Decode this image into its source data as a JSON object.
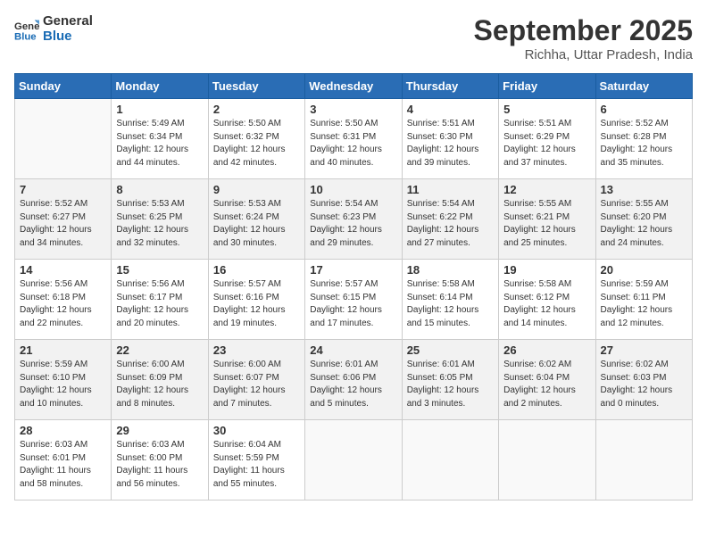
{
  "header": {
    "logo_line1": "General",
    "logo_line2": "Blue",
    "month": "September 2025",
    "location": "Richha, Uttar Pradesh, India"
  },
  "weekdays": [
    "Sunday",
    "Monday",
    "Tuesday",
    "Wednesday",
    "Thursday",
    "Friday",
    "Saturday"
  ],
  "weeks": [
    [
      {
        "day": "",
        "sunrise": "",
        "sunset": "",
        "daylight": ""
      },
      {
        "day": "1",
        "sunrise": "Sunrise: 5:49 AM",
        "sunset": "Sunset: 6:34 PM",
        "daylight": "Daylight: 12 hours and 44 minutes."
      },
      {
        "day": "2",
        "sunrise": "Sunrise: 5:50 AM",
        "sunset": "Sunset: 6:32 PM",
        "daylight": "Daylight: 12 hours and 42 minutes."
      },
      {
        "day": "3",
        "sunrise": "Sunrise: 5:50 AM",
        "sunset": "Sunset: 6:31 PM",
        "daylight": "Daylight: 12 hours and 40 minutes."
      },
      {
        "day": "4",
        "sunrise": "Sunrise: 5:51 AM",
        "sunset": "Sunset: 6:30 PM",
        "daylight": "Daylight: 12 hours and 39 minutes."
      },
      {
        "day": "5",
        "sunrise": "Sunrise: 5:51 AM",
        "sunset": "Sunset: 6:29 PM",
        "daylight": "Daylight: 12 hours and 37 minutes."
      },
      {
        "day": "6",
        "sunrise": "Sunrise: 5:52 AM",
        "sunset": "Sunset: 6:28 PM",
        "daylight": "Daylight: 12 hours and 35 minutes."
      }
    ],
    [
      {
        "day": "7",
        "sunrise": "Sunrise: 5:52 AM",
        "sunset": "Sunset: 6:27 PM",
        "daylight": "Daylight: 12 hours and 34 minutes."
      },
      {
        "day": "8",
        "sunrise": "Sunrise: 5:53 AM",
        "sunset": "Sunset: 6:25 PM",
        "daylight": "Daylight: 12 hours and 32 minutes."
      },
      {
        "day": "9",
        "sunrise": "Sunrise: 5:53 AM",
        "sunset": "Sunset: 6:24 PM",
        "daylight": "Daylight: 12 hours and 30 minutes."
      },
      {
        "day": "10",
        "sunrise": "Sunrise: 5:54 AM",
        "sunset": "Sunset: 6:23 PM",
        "daylight": "Daylight: 12 hours and 29 minutes."
      },
      {
        "day": "11",
        "sunrise": "Sunrise: 5:54 AM",
        "sunset": "Sunset: 6:22 PM",
        "daylight": "Daylight: 12 hours and 27 minutes."
      },
      {
        "day": "12",
        "sunrise": "Sunrise: 5:55 AM",
        "sunset": "Sunset: 6:21 PM",
        "daylight": "Daylight: 12 hours and 25 minutes."
      },
      {
        "day": "13",
        "sunrise": "Sunrise: 5:55 AM",
        "sunset": "Sunset: 6:20 PM",
        "daylight": "Daylight: 12 hours and 24 minutes."
      }
    ],
    [
      {
        "day": "14",
        "sunrise": "Sunrise: 5:56 AM",
        "sunset": "Sunset: 6:18 PM",
        "daylight": "Daylight: 12 hours and 22 minutes."
      },
      {
        "day": "15",
        "sunrise": "Sunrise: 5:56 AM",
        "sunset": "Sunset: 6:17 PM",
        "daylight": "Daylight: 12 hours and 20 minutes."
      },
      {
        "day": "16",
        "sunrise": "Sunrise: 5:57 AM",
        "sunset": "Sunset: 6:16 PM",
        "daylight": "Daylight: 12 hours and 19 minutes."
      },
      {
        "day": "17",
        "sunrise": "Sunrise: 5:57 AM",
        "sunset": "Sunset: 6:15 PM",
        "daylight": "Daylight: 12 hours and 17 minutes."
      },
      {
        "day": "18",
        "sunrise": "Sunrise: 5:58 AM",
        "sunset": "Sunset: 6:14 PM",
        "daylight": "Daylight: 12 hours and 15 minutes."
      },
      {
        "day": "19",
        "sunrise": "Sunrise: 5:58 AM",
        "sunset": "Sunset: 6:12 PM",
        "daylight": "Daylight: 12 hours and 14 minutes."
      },
      {
        "day": "20",
        "sunrise": "Sunrise: 5:59 AM",
        "sunset": "Sunset: 6:11 PM",
        "daylight": "Daylight: 12 hours and 12 minutes."
      }
    ],
    [
      {
        "day": "21",
        "sunrise": "Sunrise: 5:59 AM",
        "sunset": "Sunset: 6:10 PM",
        "daylight": "Daylight: 12 hours and 10 minutes."
      },
      {
        "day": "22",
        "sunrise": "Sunrise: 6:00 AM",
        "sunset": "Sunset: 6:09 PM",
        "daylight": "Daylight: 12 hours and 8 minutes."
      },
      {
        "day": "23",
        "sunrise": "Sunrise: 6:00 AM",
        "sunset": "Sunset: 6:07 PM",
        "daylight": "Daylight: 12 hours and 7 minutes."
      },
      {
        "day": "24",
        "sunrise": "Sunrise: 6:01 AM",
        "sunset": "Sunset: 6:06 PM",
        "daylight": "Daylight: 12 hours and 5 minutes."
      },
      {
        "day": "25",
        "sunrise": "Sunrise: 6:01 AM",
        "sunset": "Sunset: 6:05 PM",
        "daylight": "Daylight: 12 hours and 3 minutes."
      },
      {
        "day": "26",
        "sunrise": "Sunrise: 6:02 AM",
        "sunset": "Sunset: 6:04 PM",
        "daylight": "Daylight: 12 hours and 2 minutes."
      },
      {
        "day": "27",
        "sunrise": "Sunrise: 6:02 AM",
        "sunset": "Sunset: 6:03 PM",
        "daylight": "Daylight: 12 hours and 0 minutes."
      }
    ],
    [
      {
        "day": "28",
        "sunrise": "Sunrise: 6:03 AM",
        "sunset": "Sunset: 6:01 PM",
        "daylight": "Daylight: 11 hours and 58 minutes."
      },
      {
        "day": "29",
        "sunrise": "Sunrise: 6:03 AM",
        "sunset": "Sunset: 6:00 PM",
        "daylight": "Daylight: 11 hours and 56 minutes."
      },
      {
        "day": "30",
        "sunrise": "Sunrise: 6:04 AM",
        "sunset": "Sunset: 5:59 PM",
        "daylight": "Daylight: 11 hours and 55 minutes."
      },
      {
        "day": "",
        "sunrise": "",
        "sunset": "",
        "daylight": ""
      },
      {
        "day": "",
        "sunrise": "",
        "sunset": "",
        "daylight": ""
      },
      {
        "day": "",
        "sunrise": "",
        "sunset": "",
        "daylight": ""
      },
      {
        "day": "",
        "sunrise": "",
        "sunset": "",
        "daylight": ""
      }
    ]
  ]
}
